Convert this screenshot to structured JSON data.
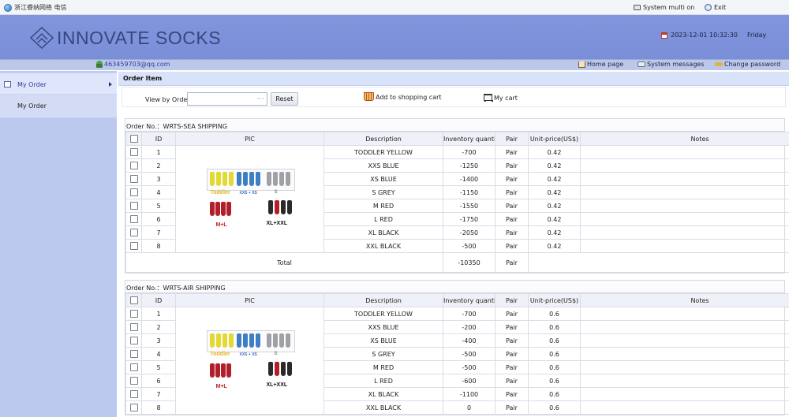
{
  "topbar": {
    "brand_text": "浙江睿纳网络 电信",
    "system_multi": "System multi on",
    "exit": "Exit"
  },
  "header": {
    "logo_text": "INNOVATE SOCKS",
    "datetime": "2023-12-01 10:32:30",
    "weekday": "Friday"
  },
  "userbar": {
    "email": "463459703@qq.com",
    "home": "Home page",
    "messages": "System messages",
    "change_password": "Change password"
  },
  "sidebar": {
    "menu_label": "My Order",
    "sub_label": "My Order"
  },
  "main": {
    "title": "Order Item",
    "view_by_label": "View by Order：",
    "view_by_value": "",
    "picker": "···",
    "reset": "Reset",
    "add_cart": "Add to shopping cart",
    "my_cart": "My cart"
  },
  "columns": [
    "ID",
    "PIC",
    "Description",
    "Inventory quantity",
    "Pair",
    "Unit-price(US$)",
    "Notes"
  ],
  "orders": [
    {
      "label": "Order No.：WRTS-SEA SHIPPING",
      "rows": [
        {
          "id": "1",
          "desc": "TODDLER  YELLOW",
          "qty": "-700",
          "unit": "Pair",
          "price": "0.42",
          "notes": ""
        },
        {
          "id": "2",
          "desc": "XXS  BLUE",
          "qty": "-1250",
          "unit": "Pair",
          "price": "0.42",
          "notes": ""
        },
        {
          "id": "3",
          "desc": "XS  BLUE",
          "qty": "-1400",
          "unit": "Pair",
          "price": "0.42",
          "notes": ""
        },
        {
          "id": "4",
          "desc": "S  GREY",
          "qty": "-1150",
          "unit": "Pair",
          "price": "0.42",
          "notes": ""
        },
        {
          "id": "5",
          "desc": "M  RED",
          "qty": "-1550",
          "unit": "Pair",
          "price": "0.42",
          "notes": ""
        },
        {
          "id": "6",
          "desc": "L  RED",
          "qty": "-1750",
          "unit": "Pair",
          "price": "0.42",
          "notes": ""
        },
        {
          "id": "7",
          "desc": "XL  BLACK",
          "qty": "-2050",
          "unit": "Pair",
          "price": "0.42",
          "notes": ""
        },
        {
          "id": "8",
          "desc": "XXL  BLACK",
          "qty": "-500",
          "unit": "Pair",
          "price": "0.42",
          "notes": ""
        }
      ],
      "total_label": "Total",
      "total_qty": "-10350",
      "total_unit": "Pair"
    },
    {
      "label": "Order No.：WRTS-AIR SHIPPING",
      "rows": [
        {
          "id": "1",
          "desc": "TODDLER  YELLOW",
          "qty": "-700",
          "unit": "Pair",
          "price": "0.6",
          "notes": ""
        },
        {
          "id": "2",
          "desc": "XXS  BLUE",
          "qty": "-200",
          "unit": "Pair",
          "price": "0.6",
          "notes": ""
        },
        {
          "id": "3",
          "desc": "XS  BLUE",
          "qty": "-400",
          "unit": "Pair",
          "price": "0.6",
          "notes": ""
        },
        {
          "id": "4",
          "desc": "S  GREY",
          "qty": "-500",
          "unit": "Pair",
          "price": "0.6",
          "notes": ""
        },
        {
          "id": "5",
          "desc": "M  RED",
          "qty": "-500",
          "unit": "Pair",
          "price": "0.6",
          "notes": ""
        },
        {
          "id": "6",
          "desc": "L  RED",
          "qty": "-600",
          "unit": "Pair",
          "price": "0.6",
          "notes": ""
        },
        {
          "id": "7",
          "desc": "XL  BLACK",
          "qty": "-1100",
          "unit": "Pair",
          "price": "0.6",
          "notes": ""
        },
        {
          "id": "8",
          "desc": "XXL  BLACK",
          "qty": "0",
          "unit": "Pair",
          "price": "0.6",
          "notes": ""
        }
      ]
    }
  ],
  "picture": {
    "labels": {
      "toddler": "Toddler",
      "xxs_xs": "XXS + XS",
      "s": "S",
      "m_l": "M+L",
      "xl_xxl": "XL+XXL"
    },
    "colors": {
      "yellow": "#e4d832",
      "blue": "#3d7fc4",
      "grey": "#9ea2a6",
      "red": "#b11f2b",
      "black": "#2a2a2a"
    }
  },
  "colors": {
    "header": "#7f95dc",
    "userbar": "#bcc8ea",
    "sidebar": "#bcc9ee",
    "link": "#2b3ca0"
  }
}
